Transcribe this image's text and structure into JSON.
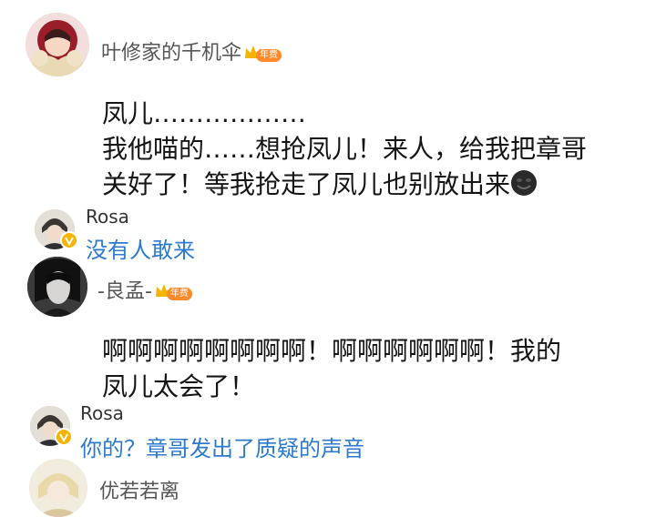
{
  "comments": [
    {
      "username": "叶修家的千机伞",
      "badge": {
        "label": "年费",
        "icon": "crown-icon"
      },
      "lines": [
        "凤儿………………",
        "我他喵的……想抢凤儿！来人，给我把章哥",
        "关好了！等我抢走了凤儿也别放出来"
      ],
      "emoji": "dark-grin-face-icon"
    },
    {
      "username": "-良孟-",
      "badge": {
        "label": "年费",
        "icon": "crown-icon"
      },
      "lines": [
        "啊啊啊啊啊啊啊啊！啊啊啊啊啊啊！我的",
        "凤儿太会了！"
      ]
    },
    {
      "username": "优若若离"
    }
  ],
  "replies": [
    {
      "username": "Rosa",
      "text": "没有人敢来",
      "verified_icon": "verified-v-icon"
    },
    {
      "username": "Rosa",
      "text": "你的？章哥发出了质疑的声音",
      "verified_icon": "verified-v-icon"
    }
  ],
  "colors": {
    "reply_text": "#2b7ad0",
    "username": "#555555",
    "badge": "#ff8a2a",
    "crown": "#f5b400"
  }
}
